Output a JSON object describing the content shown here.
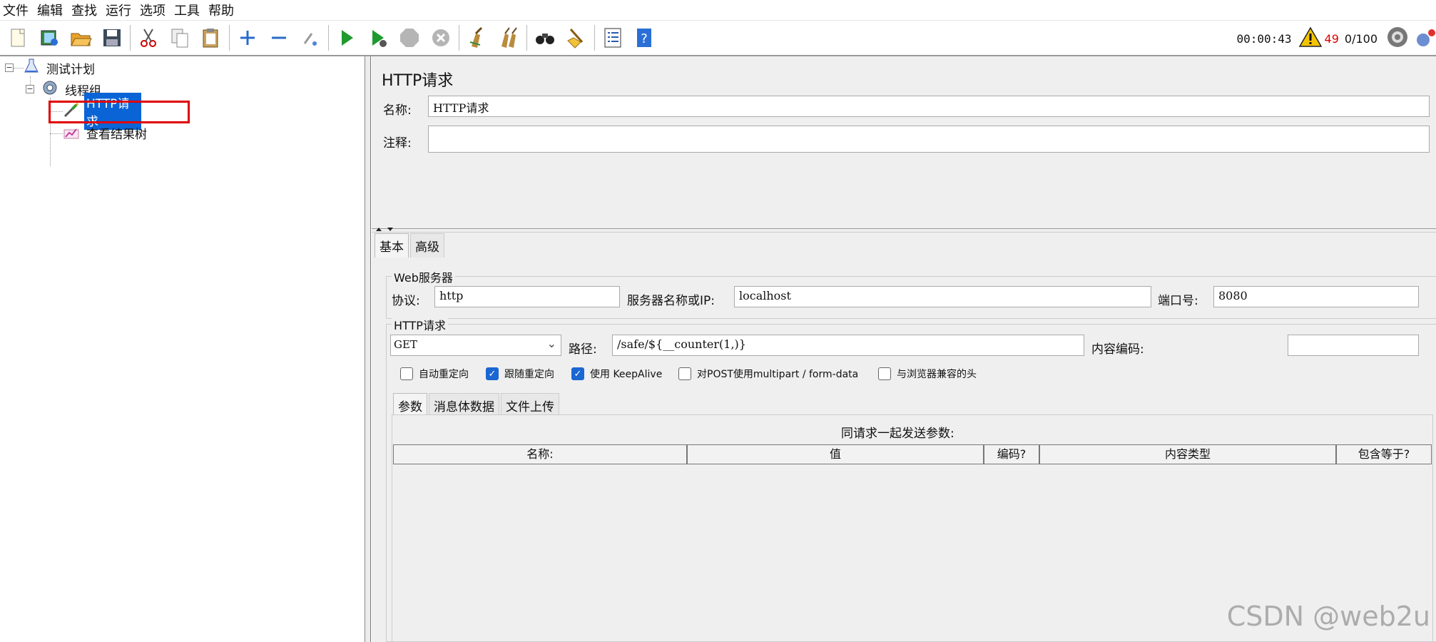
{
  "menu": [
    "文件",
    "编辑",
    "查找",
    "运行",
    "选项",
    "工具",
    "帮助"
  ],
  "toolbar": {
    "icons": [
      "new-icon",
      "templates-icon",
      "open-icon",
      "save-icon",
      "cut-icon",
      "copy-icon",
      "paste-icon",
      "expand-icon",
      "collapse-icon",
      "toggle-icon",
      "start-icon",
      "start-no-pause-icon",
      "stop-icon",
      "shutdown-icon",
      "clear-icon",
      "clear-all-icon",
      "search-icon",
      "reset-search-icon",
      "function-helper-icon",
      "help-icon"
    ],
    "timer": "00:00:43",
    "warning_count": "49",
    "threads": "0/100"
  },
  "tree": {
    "plan": "测试计划",
    "thread_group": "线程组",
    "http_request": "HTTP请求",
    "result_tree": "查看结果树"
  },
  "panel": {
    "title": "HTTP请求",
    "name_label": "名称:",
    "name_value": "HTTP请求",
    "comment_label": "注释:",
    "comment_value": "",
    "tabs": [
      "基本",
      "高级"
    ],
    "web_server": {
      "group_title": "Web服务器",
      "protocol_label": "协议:",
      "protocol_value": "http",
      "server_label": "服务器名称或IP:",
      "server_value": "localhost",
      "port_label": "端口号:",
      "port_value": "8080"
    },
    "http_request": {
      "group_title": "HTTP请求",
      "method": "GET",
      "path_label": "路径:",
      "path_value": "/safe/${__counter(1,)}",
      "encoding_label": "内容编码:",
      "encoding_value": ""
    },
    "options": [
      {
        "label": "自动重定向",
        "checked": false
      },
      {
        "label": "跟随重定向",
        "checked": true
      },
      {
        "label": "使用 KeepAlive",
        "checked": true
      },
      {
        "label": "对POST使用multipart / form-data",
        "checked": false
      },
      {
        "label": "与浏览器兼容的头",
        "checked": false
      }
    ],
    "sub_tabs": [
      "参数",
      "消息体数据",
      "文件上传"
    ],
    "params_caption": "同请求一起发送参数:",
    "columns": [
      "名称:",
      "值",
      "编码?",
      "内容类型",
      "包含等于?"
    ]
  },
  "watermark": "CSDN @web2u"
}
